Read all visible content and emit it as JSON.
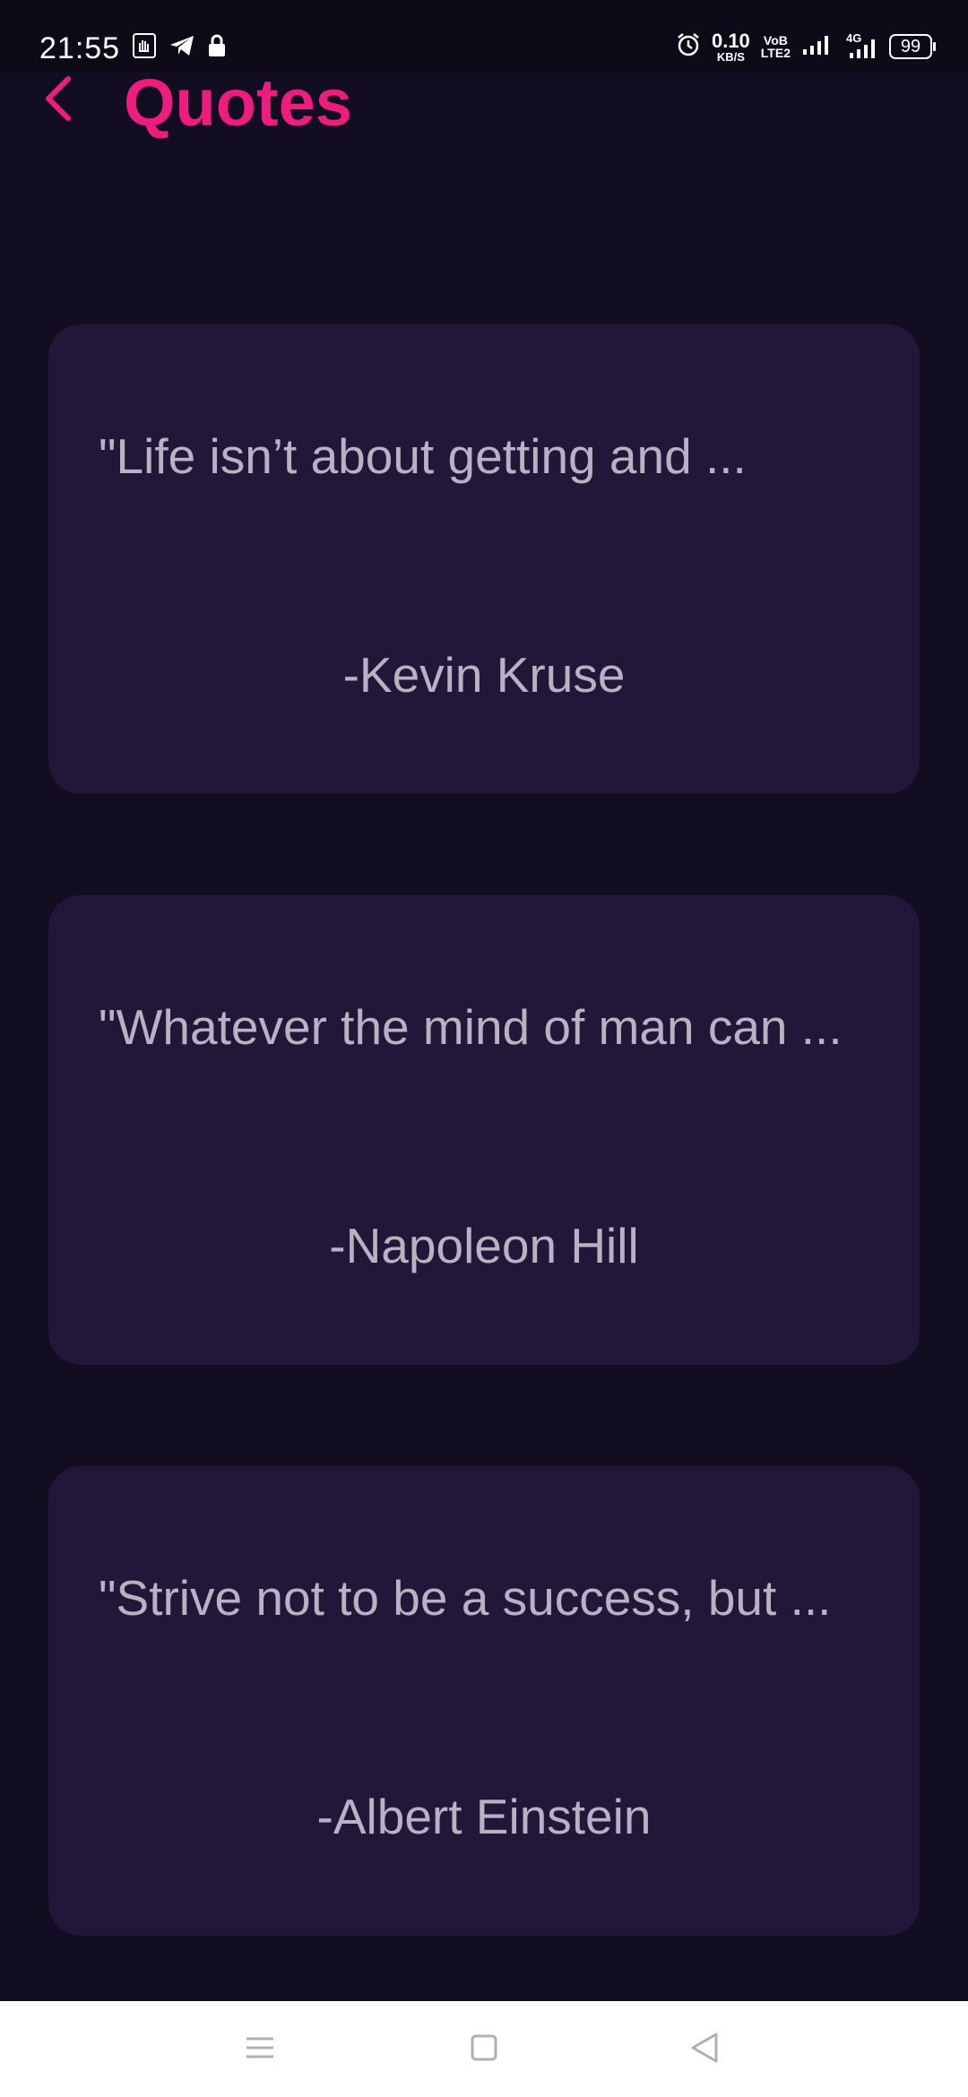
{
  "status_bar": {
    "time": "21:55",
    "net_speed_value": "0.10",
    "net_speed_unit": "KB/S",
    "volte_top": "VoB",
    "volte_bottom": "LTE2",
    "network_label": "4G",
    "battery": "99",
    "icons": [
      "notification-app-icon",
      "telegram-icon",
      "lock-icon",
      "alarm-icon",
      "signal-icon",
      "signal-4g-icon",
      "battery-icon"
    ]
  },
  "header": {
    "back_icon": "chevron-left-icon",
    "title": "Quotes"
  },
  "quotes": [
    {
      "text": "\"Life isn’t about getting and ...",
      "author": "-Kevin Kruse"
    },
    {
      "text": "\"Whatever the mind of man can ...",
      "author": "-Napoleon Hill"
    },
    {
      "text": "\"Strive not to be a success, but ...",
      "author": "-Albert Einstein"
    }
  ],
  "nav_bar": {
    "icons": [
      "menu-icon",
      "home-square-icon",
      "back-triangle-icon"
    ]
  },
  "colors": {
    "accent": "#ee1c7e",
    "background": "#130d21",
    "card": "#221739",
    "text": "#b8b2c2"
  }
}
